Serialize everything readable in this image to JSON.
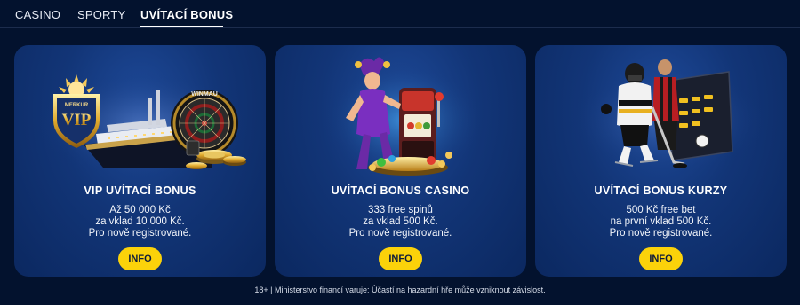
{
  "tabs": [
    {
      "label": "CASINO"
    },
    {
      "label": "SPORTY"
    },
    {
      "label": "UVÍTACÍ BONUS"
    }
  ],
  "active_tab": "UVÍTACÍ BONUS",
  "cards": [
    {
      "title": "VIP UVÍTACÍ BONUS",
      "lines": [
        "Až 50 000 Kč",
        "za vklad 10 000 Kč.",
        "Pro nově registrované."
      ],
      "button": "INFO",
      "art": {
        "badge_top": "MERKUR",
        "badge_main": "VIP",
        "dartboard_text": "WINMAU"
      }
    },
    {
      "title": "UVÍTACÍ BONUS CASINO",
      "lines": [
        "333 free spinů",
        "za vklad 500 Kč.",
        "Pro nově registrované."
      ],
      "button": "INFO"
    },
    {
      "title": "UVÍTACÍ BONUS KURZY",
      "lines": [
        "500 Kč free bet",
        "na první vklad 500 Kč.",
        "Pro nově registrované."
      ],
      "button": "INFO"
    }
  ],
  "footer": "18+ | Ministerstvo financí varuje: Účastí na hazardní hře může vzniknout závislost.",
  "colors": {
    "background": "#03122e",
    "card": "#123577",
    "button": "#fbd20a",
    "button_text": "#0d1a3a"
  }
}
